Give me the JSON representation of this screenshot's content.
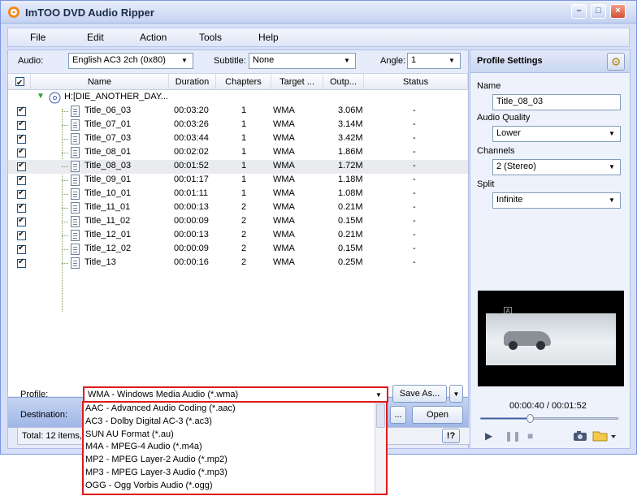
{
  "app": {
    "title": "ImTOO DVD Audio Ripper"
  },
  "menu": {
    "file": "File",
    "edit": "Edit",
    "action": "Action",
    "tools": "Tools",
    "help": "Help"
  },
  "options": {
    "audio_label": "Audio:",
    "audio_value": "English AC3 2ch (0x80)",
    "subtitle_label": "Subtitle:",
    "subtitle_value": "None",
    "angle_label": "Angle:",
    "angle_value": "1"
  },
  "columns": {
    "name": "Name",
    "duration": "Duration",
    "chapters": "Chapters",
    "target": "Target ...",
    "output": "Outp...",
    "status": "Status"
  },
  "root": {
    "label": "H:[DIE_ANOTHER_DAY..."
  },
  "rows": [
    {
      "name": "Title_06_03",
      "duration": "00:03:20",
      "chapters": "1",
      "target": "WMA",
      "output": "3.06M",
      "status": "-"
    },
    {
      "name": "Title_07_01",
      "duration": "00:03:26",
      "chapters": "1",
      "target": "WMA",
      "output": "3.14M",
      "status": "-"
    },
    {
      "name": "Title_07_03",
      "duration": "00:03:44",
      "chapters": "1",
      "target": "WMA",
      "output": "3.42M",
      "status": "-"
    },
    {
      "name": "Title_08_01",
      "duration": "00:02:02",
      "chapters": "1",
      "target": "WMA",
      "output": "1.86M",
      "status": "-"
    },
    {
      "name": "Title_08_03",
      "duration": "00:01:52",
      "chapters": "1",
      "target": "WMA",
      "output": "1.72M",
      "status": "-"
    },
    {
      "name": "Title_09_01",
      "duration": "00:01:17",
      "chapters": "1",
      "target": "WMA",
      "output": "1.18M",
      "status": "-"
    },
    {
      "name": "Title_10_01",
      "duration": "00:01:11",
      "chapters": "1",
      "target": "WMA",
      "output": "1.08M",
      "status": "-"
    },
    {
      "name": "Title_11_01",
      "duration": "00:00:13",
      "chapters": "2",
      "target": "WMA",
      "output": "0.21M",
      "status": "-"
    },
    {
      "name": "Title_11_02",
      "duration": "00:00:09",
      "chapters": "2",
      "target": "WMA",
      "output": "0.15M",
      "status": "-"
    },
    {
      "name": "Title_12_01",
      "duration": "00:00:13",
      "chapters": "2",
      "target": "WMA",
      "output": "0.21M",
      "status": "-"
    },
    {
      "name": "Title_12_02",
      "duration": "00:00:09",
      "chapters": "2",
      "target": "WMA",
      "output": "0.15M",
      "status": "-"
    },
    {
      "name": "Title_13",
      "duration": "00:00:16",
      "chapters": "2",
      "target": "WMA",
      "output": "0.25M",
      "status": "-"
    }
  ],
  "selected_row": "Title_08_03",
  "bottom": {
    "profile_label": "Profile:",
    "profile_value": "WMA - Windows Media Audio  (*.wma)",
    "save_as": "Save As...",
    "destination_label": "Destination:",
    "browse": "...",
    "open": "Open",
    "total": "Total: 12 items,",
    "help": "!?"
  },
  "profile_options": [
    "AAC - Advanced Audio Coding  (*.aac)",
    "AC3 - Dolby Digital AC-3  (*.ac3)",
    "SUN AU Format  (*.au)",
    "M4A - MPEG-4 Audio  (*.m4a)",
    "MP2 - MPEG Layer-2 Audio  (*.mp2)",
    "MP3 - MPEG Layer-3 Audio  (*.mp3)",
    "OGG - Ogg Vorbis Audio  (*.ogg)"
  ],
  "profile_settings": {
    "title": "Profile Settings",
    "name_label": "Name",
    "name_value": "Title_08_03",
    "quality_label": "Audio Quality",
    "quality_value": "Lower",
    "channels_label": "Channels",
    "channels_value": "2 (Stereo)",
    "split_label": "Split",
    "split_value": "Infinite"
  },
  "player": {
    "time": "00:00:40 / 00:01:52",
    "position_fraction": 0.357,
    "overlay_letter": "A"
  },
  "colors": {
    "highlight_border": "#e0191c",
    "panel_bg": "#e4eaf8",
    "accent_blue": "#3a5ea8"
  }
}
